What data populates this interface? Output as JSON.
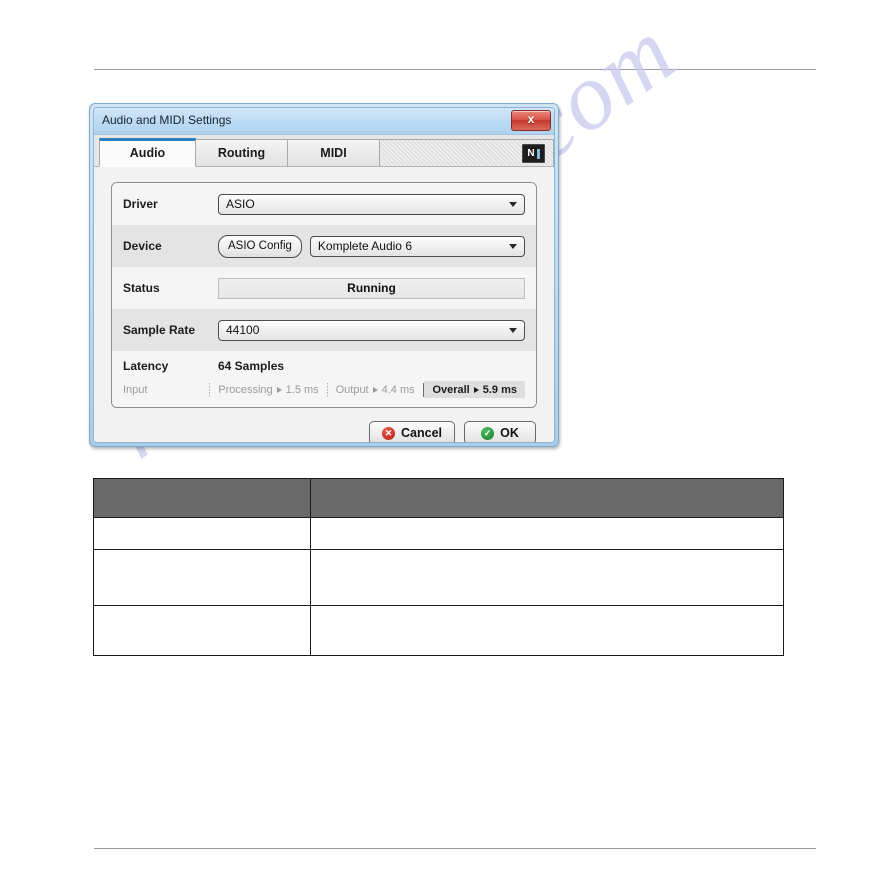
{
  "page": {
    "top_rule": true,
    "bottom_rule": true,
    "watermark": "manualslive.com"
  },
  "dialog": {
    "title": "Audio and MIDI Settings",
    "close_label": "x",
    "logo": {
      "name": "Native Instruments",
      "letter": "N"
    },
    "tabs": [
      {
        "label": "Audio",
        "active": true
      },
      {
        "label": "Routing",
        "active": false
      },
      {
        "label": "MIDI",
        "active": false
      }
    ],
    "rows": {
      "driver": {
        "label": "Driver",
        "value": "ASIO"
      },
      "device": {
        "label": "Device",
        "config_button": "ASIO Config",
        "value": "Komplete Audio 6"
      },
      "status": {
        "label": "Status",
        "value": "Running"
      },
      "sample_rate": {
        "label": "Sample Rate",
        "value": "44100"
      }
    },
    "latency": {
      "label": "Latency",
      "samples": "64 Samples",
      "segments": [
        {
          "name": "Input",
          "value": "",
          "highlight": false
        },
        {
          "name": "Processing",
          "value": "1.5 ms",
          "highlight": false
        },
        {
          "name": "Output",
          "value": "4.4 ms",
          "highlight": false
        },
        {
          "name": "Overall",
          "value": "5.9 ms",
          "highlight": true
        }
      ]
    },
    "buttons": {
      "cancel": "Cancel",
      "ok": "OK"
    },
    "colors": {
      "accent_blue": "#2b7fc0",
      "title_bar": "#bedcf4",
      "close_red": "#c4372b",
      "ok_green": "#117a2a",
      "cancel_red": "#b81d10",
      "table_header": "#696969",
      "watermark": "#c9c9f0"
    }
  },
  "table": {
    "headers": [
      "",
      ""
    ],
    "rows": [
      [
        "",
        ""
      ],
      [
        "",
        ""
      ],
      [
        "",
        ""
      ]
    ]
  }
}
